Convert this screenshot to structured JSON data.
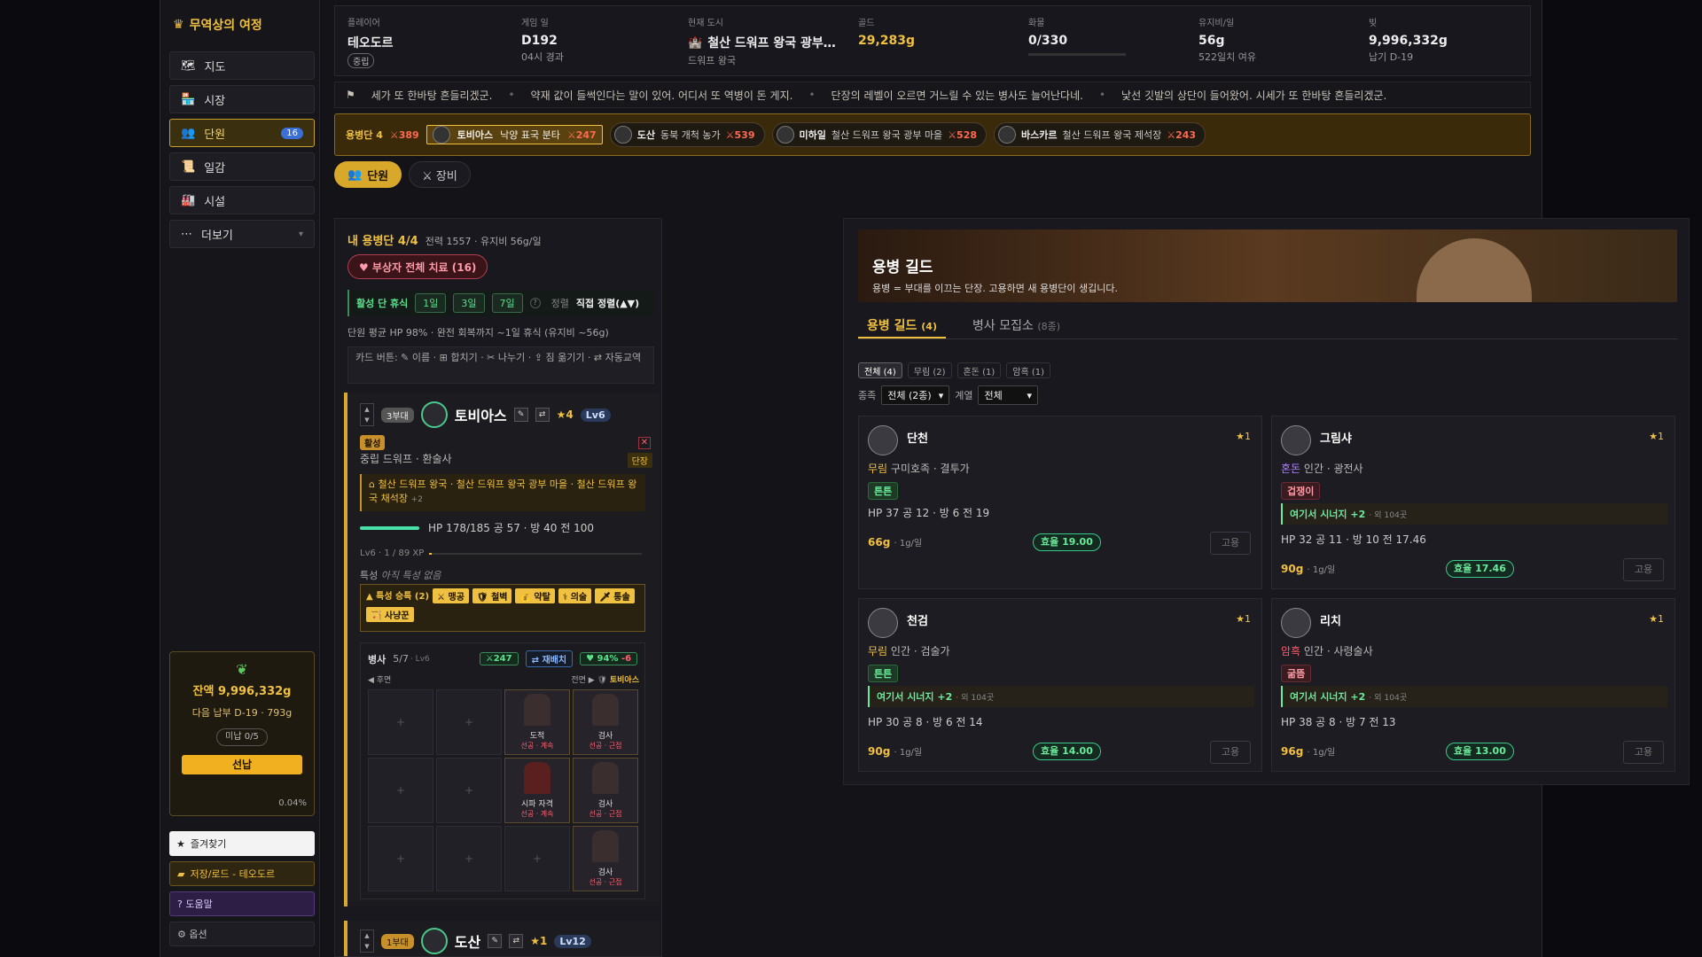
{
  "brand": {
    "icon": "crown-icon",
    "title": "무역상의 여정"
  },
  "nav": {
    "items": [
      {
        "label": "지도",
        "icon": "map-icon"
      },
      {
        "label": "시장",
        "icon": "market-icon"
      },
      {
        "label": "단원",
        "icon": "party-icon",
        "badge": "16"
      },
      {
        "label": "일감",
        "icon": "scroll-icon"
      },
      {
        "label": "시설",
        "icon": "facility-icon"
      },
      {
        "label": "더보기",
        "icon": "more-icon"
      }
    ]
  },
  "wallet": {
    "balance": "잔액 9,996,332g",
    "next_payment": "다음 납부 D-19 · 793g",
    "unpaid": "미납 0/5",
    "prepay": "선납",
    "percent": "0.04%"
  },
  "side_buttons": {
    "favorites": "즐겨찾기",
    "save_load": "저장/로드 - 테오도르",
    "help": "? 도움말",
    "options": "⚙ 옵션"
  },
  "top": {
    "player": {
      "label": "플레이어",
      "value": "테오도르",
      "tag": "중립"
    },
    "day": {
      "label": "게임 일",
      "value": "D192",
      "sub": "04시 경과"
    },
    "city": {
      "label": "현재 도시",
      "value": "철산 드워프 왕국 광부…",
      "sub": "드워프 왕국"
    },
    "gold": {
      "label": "골드",
      "value": "29,283g"
    },
    "cargo": {
      "label": "화물",
      "value": "0/330"
    },
    "upkeep": {
      "label": "유지비/일",
      "value": "56g",
      "sub": "522일치 여유"
    },
    "debt": {
      "label": "빚",
      "value": "9,996,332g",
      "sub": "납기 D-19"
    }
  },
  "news": [
    "세가 또 한바탕 흔들리겠군.",
    "약재 값이 들썩인다는 말이 있어. 어디서 또 역병이 돈 게지.",
    "단장의 레벨이 오르면 거느릴 수 있는 병사도 늘어난다네.",
    "낯선 깃발의 상단이 들어왔어. 시세가 또 한바탕 흔들리겠군."
  ],
  "party": {
    "lead_label": "용병단 4",
    "lead_power": "⚔389",
    "members": [
      {
        "name": "토비아스",
        "desc": "낙양 표국 분타",
        "power": "⚔247"
      },
      {
        "name": "도산",
        "desc": "동북 개척 농가",
        "power": "⚔539"
      },
      {
        "name": "미하일",
        "desc": "철산 드워프 왕국 광부 마을",
        "power": "⚔528"
      },
      {
        "name": "바스카르",
        "desc": "철산 드워프 왕국 제석장",
        "power": "⚔243"
      }
    ]
  },
  "main_tabs": [
    {
      "label": "단원"
    },
    {
      "label": "⚔ 장비"
    }
  ],
  "roster": {
    "title": "내 용병단 4/4",
    "meta": "전력 1557 · 유지비 56g/일",
    "heal_btn": "♥ 부상자 전체 치료 (16)",
    "rest_label": "활성 단 휴식",
    "rest_options": [
      "1일",
      "3일",
      "7일"
    ],
    "rest_help": "?",
    "sort_label": "정렬",
    "sort_value": "직접 정렬(▲▼)",
    "avg": "단원 평균 HP 98% · 완전 회복까지 ~1일 휴식 (유지비 ~56g)",
    "card_help": "카드 버튼: ✎ 이름 · ⊞ 합치기 · ✂ 나누기 · ⇪ 짐 옮기기 · ⇄ 자동교역"
  },
  "unit": {
    "squad": "3부대",
    "name": "토비아스",
    "star": "★4",
    "level": "Lv6",
    "status": "활성",
    "race": "중립   드워프 · 환술사",
    "leader_tag": "단장",
    "origin": "철산 드워프 왕국 · 철산 드워프 왕국 광부 마을 · 철산 드워프 왕국 채석장",
    "origin_more": "+2",
    "hp": "HP 178/185   공 57 · 방 40   전 100",
    "hp_ratio": 0.96,
    "xp": "Lv6 · 1 / 89 XP",
    "xp_ratio": 0.011,
    "trait_label": "특성",
    "trait_value": "아직 특성 없음",
    "inherit_label": "▲ 특성 승특 (2)",
    "inherit_chips": [
      "⚔ 맹공",
      "🛡 철벽",
      "💰 약탈",
      "⚕ 의술",
      "🗡 통솔",
      "🏹 사냥꾼"
    ],
    "soldiers": {
      "label": "병사",
      "count": "5/7",
      "count_sub": "· Lv6",
      "power": "⚔247",
      "redeploy": "⇄ 재배치",
      "morale": "♥ 94%",
      "morale_delta": "-6",
      "rear": "◀ 후면",
      "front": "전면 ▶",
      "front_leader": "토비아스",
      "cells": [
        {
          "plus": "+"
        },
        {
          "plus": "+"
        },
        {
          "role": "도적",
          "rr": "선공 · 계속"
        },
        {
          "role": "검사",
          "rr": "선공 · 근접"
        },
        {
          "plus": "+"
        },
        {
          "plus": "+"
        },
        {
          "role": "시파 자격",
          "rr": "선공 · 계속"
        },
        {
          "role": "검사",
          "rr": "선공 · 근접"
        },
        {
          "plus": "+"
        },
        {
          "plus": "+"
        },
        {
          "plus": "+"
        },
        {
          "role": "검사",
          "rr": "선공 · 근접"
        }
      ]
    }
  },
  "unit2": {
    "squad": "1부대",
    "name": "도산",
    "star": "★1",
    "level": "Lv12"
  },
  "guild": {
    "title": "용병 길드",
    "desc": "용병 = 부대를 이끄는 단장. 고용하면 새 용병단이 생깁니다.",
    "tabs": [
      {
        "label": "용병 길드",
        "count": "(4)"
      },
      {
        "label": "병사 모집소",
        "count": "(8종)"
      }
    ],
    "filters": [
      "전체 (4)",
      "무림 (2)",
      "혼돈 (1)",
      "암흑 (1)"
    ],
    "race_label": "종족",
    "race_value": "전체 (2종)",
    "class_label": "계열",
    "class_value": "전체",
    "cards": [
      {
        "name": "단천",
        "star": "★1",
        "faction": "무림",
        "race": "구미호족 · 결투가",
        "tag": "튼튼",
        "synergy": "",
        "stats": "HP 37   공 12 · 방 6   전 19",
        "cost": "66g",
        "cost_sub": "· 1g/일",
        "eff": "효율 19.00",
        "hire": "고용"
      },
      {
        "name": "그림샤",
        "star": "★1",
        "faction": "혼돈",
        "race": "인간 · 광전사",
        "tag": "겁쟁이",
        "synergy": "여기서 시너지 +2",
        "synergy_sub": "· 외 104곳",
        "stats": "HP 32   공 11 · 방 10   전 17.46",
        "cost": "90g",
        "cost_sub": "· 1g/일",
        "eff": "효율 17.46",
        "hire": "고용"
      },
      {
        "name": "천검",
        "star": "★1",
        "faction": "무림",
        "race": "인간 · 검술가",
        "tag": "튼튼",
        "synergy": "여기서 시너지 +2",
        "synergy_sub": "· 외 104곳",
        "stats": "HP 30   공 8 · 방 6   전 14",
        "cost": "90g",
        "cost_sub": "· 1g/일",
        "eff": "효율 14.00",
        "hire": "고용"
      },
      {
        "name": "리치",
        "star": "★1",
        "faction": "암흑",
        "race": "인간 · 사령술사",
        "tag": "굶뜸",
        "synergy": "여기서 시너지 +2",
        "synergy_sub": "· 외 104곳",
        "stats": "HP 38   공 8 · 방 7   전 13",
        "cost": "96g",
        "cost_sub": "· 1g/일",
        "eff": "효율 13.00",
        "hire": "고용"
      }
    ]
  }
}
